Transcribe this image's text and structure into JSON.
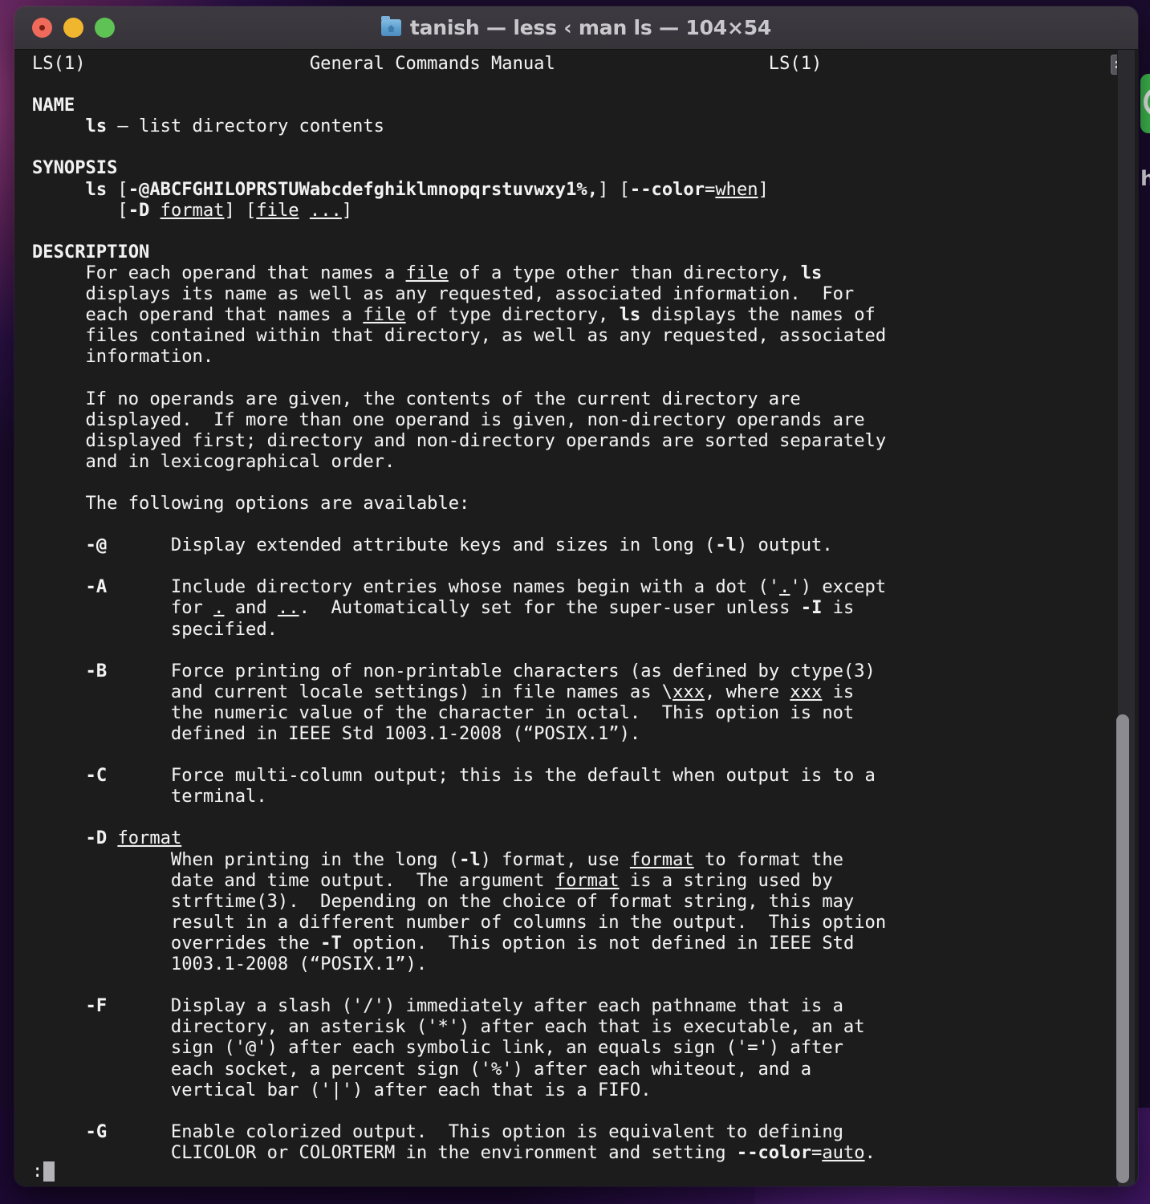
{
  "window": {
    "title": "tanish — less ‹ man ls — 104×54",
    "folder_icon": "home-folder-icon",
    "traffic_lights": [
      "close",
      "minimize",
      "maximize"
    ]
  },
  "desktop": {
    "right_icon": "whatsapp-icon",
    "right_label": "h"
  },
  "terminal": {
    "list_badge_icon": "list-lines-icon",
    "prompt": ":",
    "cursor": "block-cursor",
    "scrollbar": "vertical-scrollbar"
  },
  "manpage": {
    "header_left": "LS(1)",
    "header_center": "General Commands Manual",
    "header_right": "LS(1)",
    "lines": [
      "LS(1)                     General Commands Manual                    LS(1)",
      "",
      "§bNAME§/",
      "     §bls§/ – list directory contents",
      "",
      "§bSYNOPSIS§/",
      "     §bls§/ [§b-@ABCFGHILOPRSTUWabcdefghiklmnopqrstuvwxy1%,§/] [§b--color§/=§uwhen§/]",
      "        [§b-D§/ §uformat§/] [§ufile§/ §u...§/]",
      "",
      "§bDESCRIPTION§/",
      "     For each operand that names a §ufile§/ of a type other than directory, §bls§/",
      "     displays its name as well as any requested, associated information.  For",
      "     each operand that names a §ufile§/ of type directory, §bls§/ displays the names of",
      "     files contained within that directory, as well as any requested, associated",
      "     information.",
      "",
      "     If no operands are given, the contents of the current directory are",
      "     displayed.  If more than one operand is given, non-directory operands are",
      "     displayed first; directory and non-directory operands are sorted separately",
      "     and in lexicographical order.",
      "",
      "     The following options are available:",
      "",
      "     §b-@§/      Display extended attribute keys and sizes in long (§b-l§/) output.",
      "",
      "     §b-A§/      Include directory entries whose names begin with a dot ('§u.§/') except",
      "             for §u.§/ and §u..§/.  Automatically set for the super-user unless §b-I§/ is",
      "             specified.",
      "",
      "     §b-B§/      Force printing of non-printable characters (as defined by ctype(3)",
      "             and current locale settings) in file names as \\§uxxx§/, where §uxxx§/ is",
      "             the numeric value of the character in octal.  This option is not",
      "             defined in IEEE Std 1003.1-2008 (“POSIX.1”).",
      "",
      "     §b-C§/      Force multi-column output; this is the default when output is to a",
      "             terminal.",
      "",
      "     §b-D§/ §uformat§/",
      "             When printing in the long (§b-l§/) format, use §uformat§/ to format the",
      "             date and time output.  The argument §uformat§/ is a string used by",
      "             strftime(3).  Depending on the choice of format string, this may",
      "             result in a different number of columns in the output.  This option",
      "             overrides the §b-T§/ option.  This option is not defined in IEEE Std",
      "             1003.1-2008 (“POSIX.1”).",
      "",
      "     §b-F§/      Display a slash ('/') immediately after each pathname that is a",
      "             directory, an asterisk ('*') after each that is executable, an at",
      "             sign ('@') after each symbolic link, an equals sign ('=') after",
      "             each socket, a percent sign ('%') after each whiteout, and a",
      "             vertical bar ('|') after each that is a FIFO.",
      "",
      "     §b-G§/      Enable colorized output.  This option is equivalent to defining",
      "             CLICOLOR or COLORTERM in the environment and setting §b--color§/=§uauto§/."
    ]
  },
  "colors": {
    "terminal_bg": "#1c1c1c",
    "terminal_fg": "#f2f2f2",
    "titlebar_bg": "#3a383e",
    "title_fg": "#c9c9cd",
    "close": "#ef6a5b",
    "minimize": "#f0b62e",
    "maximize": "#5fc254",
    "scrollbar": "#8b8b90"
  }
}
